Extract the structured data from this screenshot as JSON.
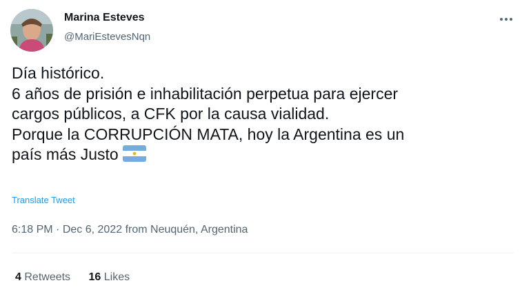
{
  "author": {
    "name": "Marina Esteves",
    "handle": "@MariEstevesNqn"
  },
  "tweet": {
    "lines": [
      "Día histórico.",
      "6 años de prisión e inhabilitación perpetua para ejercer",
      "cargos públicos, a CFK por la causa vialidad.",
      "Porque la CORRUPCIÓN MATA, hoy la Argentina es un",
      "país más Justo"
    ],
    "emoji": "argentina-flag-icon"
  },
  "translate_label": "Translate Tweet",
  "meta": {
    "time": "6:18 PM",
    "separator": "·",
    "date": "Dec 6, 2022",
    "source": "from Neuquén, Argentina"
  },
  "stats": {
    "retweets_count": "4",
    "retweets_label": "Retweets",
    "likes_count": "16",
    "likes_label": "Likes"
  },
  "colors": {
    "text": "#0f1419",
    "secondary": "#536471",
    "link": "#1d9bf0",
    "divider": "#eff3f4",
    "flag_blue": "#74acdf",
    "flag_sun": "#f6b40e"
  }
}
